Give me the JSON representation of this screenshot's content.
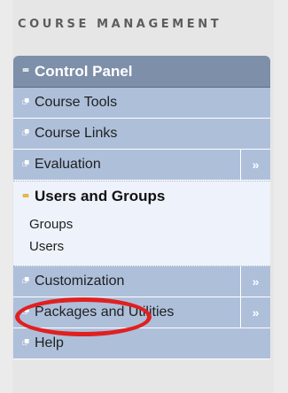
{
  "heading": "COURSE MANAGEMENT",
  "control_panel": {
    "label": "Control Panel"
  },
  "rows_top": [
    {
      "label": "Course Tools",
      "expandable": false
    },
    {
      "label": "Course Links",
      "expandable": false
    },
    {
      "label": "Evaluation",
      "expandable": true
    }
  ],
  "users_groups": {
    "label": "Users and Groups",
    "items": [
      "Groups",
      "Users"
    ]
  },
  "rows_bottom": [
    {
      "label": "Customization",
      "expandable": true
    },
    {
      "label": "Packages and Utilities",
      "expandable": true
    },
    {
      "label": "Help",
      "expandable": false
    }
  ],
  "icons": {
    "collapse": "double-chevron-up-icon",
    "expand_down": "double-chevron-down-icon",
    "flyout": "double-chevron-right-icon"
  },
  "colors": {
    "header_bg": "#7d8fa9",
    "row_bg": "#aebfda",
    "active_bg": "#eef3fb",
    "highlight_ring": "#e02020"
  }
}
